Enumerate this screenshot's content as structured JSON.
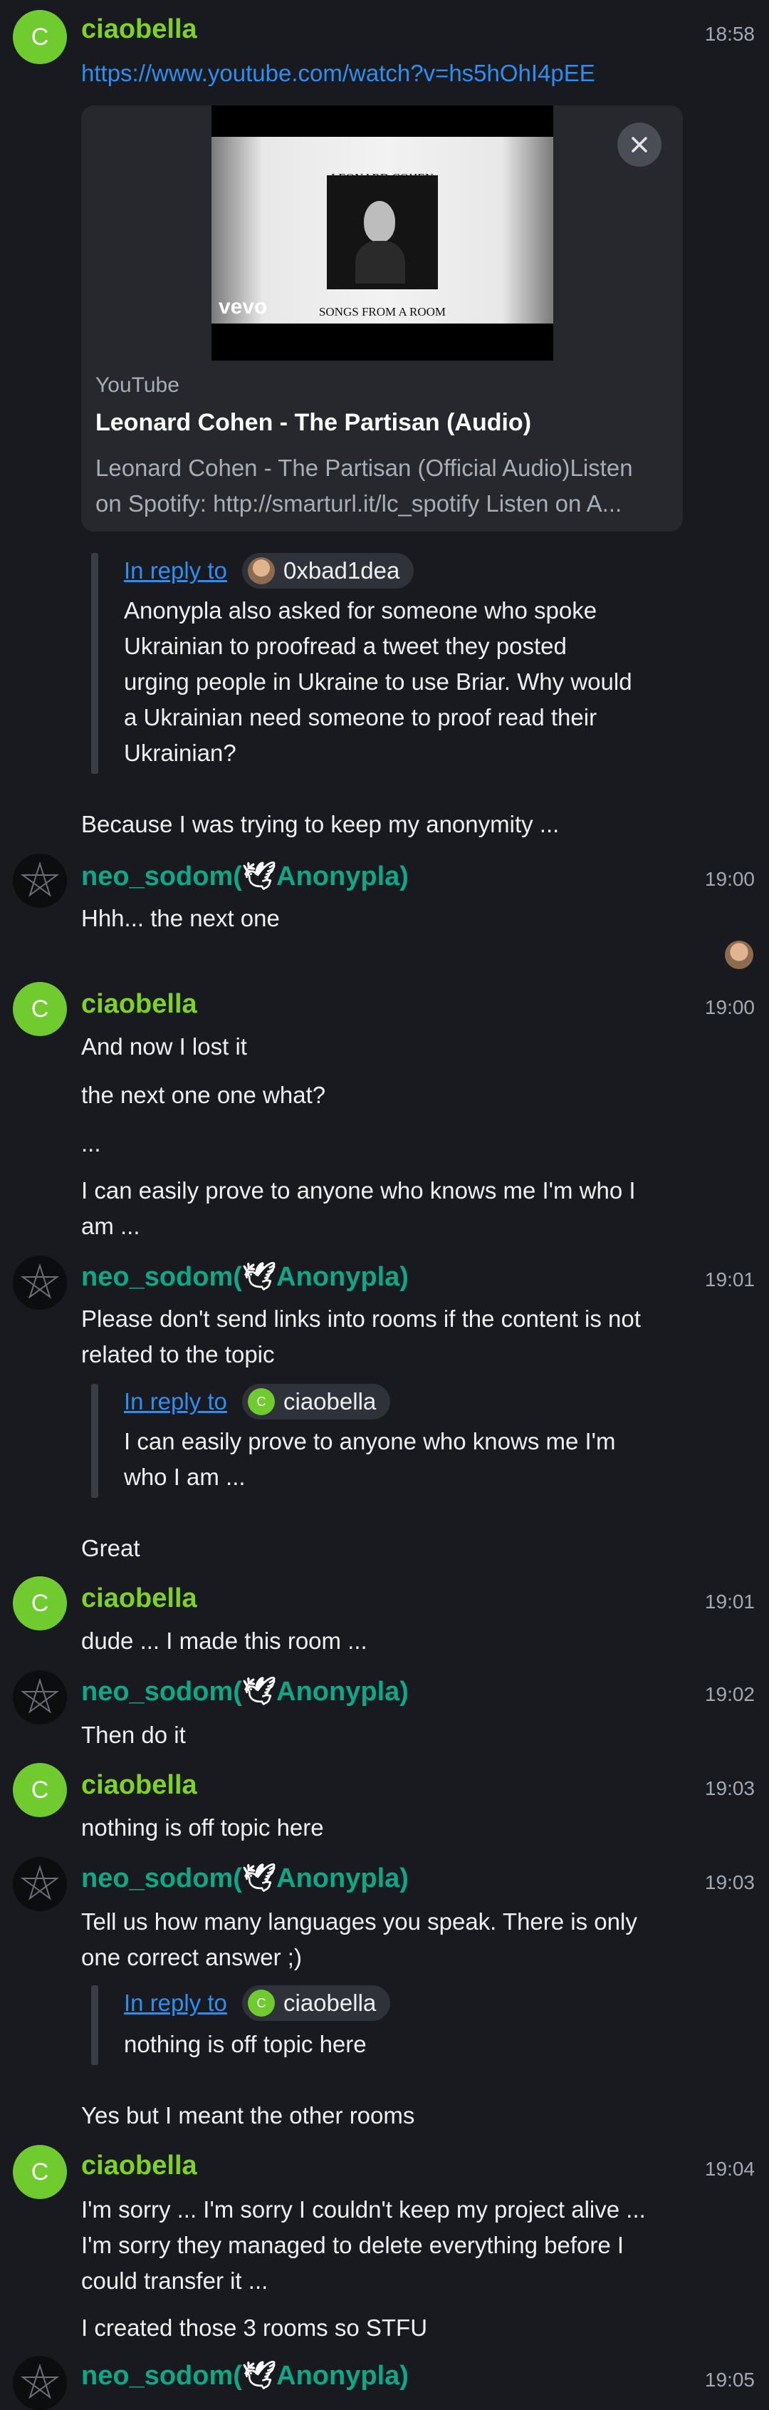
{
  "avatars": {
    "ciaobella_letter": "C"
  },
  "m1": {
    "sender": "ciaobella",
    "time": "18:58",
    "link": "https://www.youtube.com/watch?v=hs5hOhI4pEE"
  },
  "preview": {
    "site": "YouTube",
    "title": "Leonard Cohen - The Partisan (Audio)",
    "desc_line1": "Leonard Cohen - The Partisan (Official Audio)Listen",
    "desc_line2": "on Spotify: http://smarturl.it/lc_spotify Listen on A...",
    "thumb_top": "LEONARD COHEN",
    "thumb_bottom": "SONGS FROM A ROOM",
    "thumb_brand": "vevo"
  },
  "reply1": {
    "label": "In reply to",
    "user": "0xbad1dea",
    "l1": "Anonypla also asked for someone who spoke",
    "l2": "Ukrainian to proofread a tweet they posted",
    "l3": "urging people in Ukraine to use Briar. Why would",
    "l4": "a Ukrainian need someone to proof read their",
    "l5": "Ukrainian?"
  },
  "m1b": "Because I was trying to keep my anonymity ...",
  "m2": {
    "sender_a": "neo_sodom(",
    "sender_b": "Anonypla)",
    "time": "19:00",
    "text": "Hhh... the next one"
  },
  "m3": {
    "sender": "ciaobella",
    "time": "19:00",
    "t1": "And now I lost it",
    "t2": "the next one one what?",
    "t3": "...",
    "t4a": "I can easily prove to anyone who knows me I'm who I",
    "t4b": "am ..."
  },
  "m4": {
    "sender_a": "neo_sodom(",
    "sender_b": "Anonypla)",
    "time": "19:01",
    "t1": "Please don't send links into rooms if the content is not",
    "t2": "related to the topic",
    "reply_label": "In reply to",
    "reply_user": "ciaobella",
    "reply_l1": "I can easily prove to anyone who knows me I'm",
    "reply_l2": "who I am ...",
    "t3": "Great"
  },
  "m5": {
    "sender": "ciaobella",
    "time": "19:01",
    "text": "dude ... I made this room ..."
  },
  "m6": {
    "sender_a": "neo_sodom(",
    "sender_b": "Anonypla)",
    "time": "19:02",
    "text": "Then do it"
  },
  "m7": {
    "sender": "ciaobella",
    "time": "19:03",
    "text": "nothing is off topic here"
  },
  "m8": {
    "sender_a": "neo_sodom(",
    "sender_b": "Anonypla)",
    "time": "19:03",
    "t1": "Tell us how many languages you speak. There is only",
    "t2": "one correct answer ;)",
    "reply_label": "In reply to",
    "reply_user": "ciaobella",
    "reply_l1": "nothing is off topic here",
    "t3": "Yes but I meant the other rooms"
  },
  "m9": {
    "sender": "ciaobella",
    "time": "19:04",
    "t1": "I'm sorry ... I'm sorry I couldn't keep my project alive ...",
    "t2": "I'm sorry they managed to delete everything before I",
    "t3": "could transfer it ...",
    "t4": "I created those 3 rooms so STFU"
  },
  "m10": {
    "sender_a": "neo_sodom(",
    "sender_b": "Anonypla)",
    "time": "19:05"
  }
}
